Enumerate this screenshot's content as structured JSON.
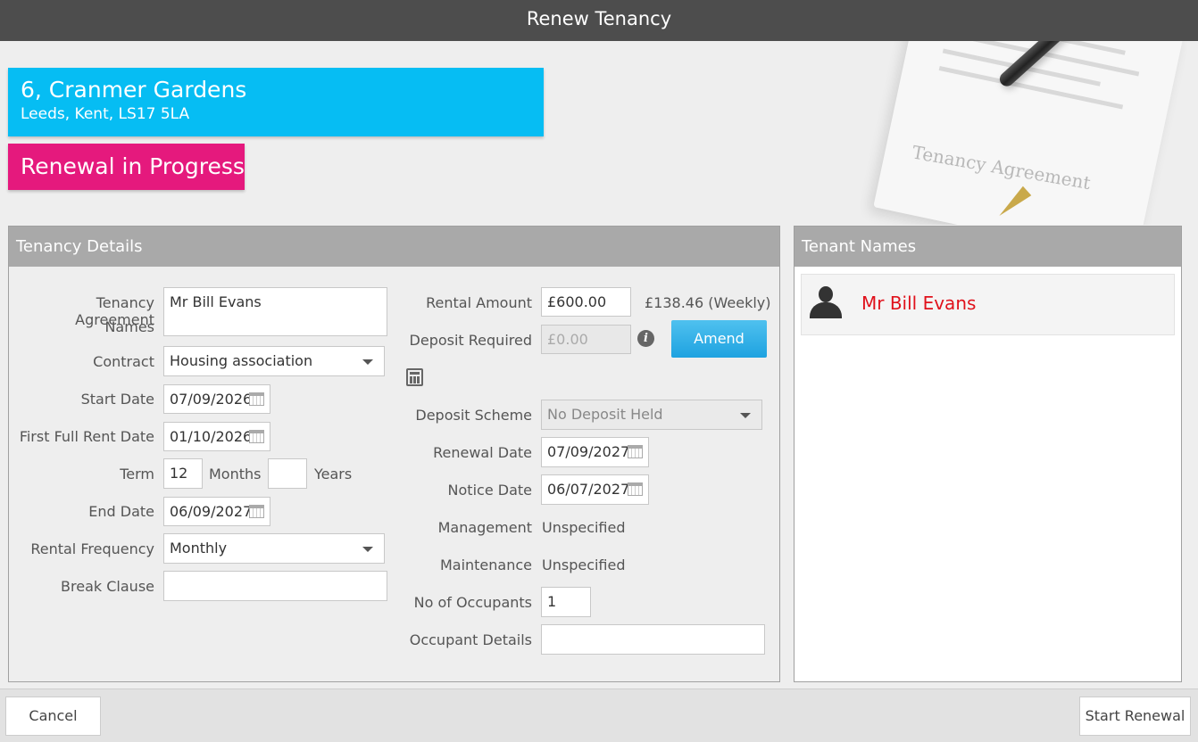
{
  "window": {
    "title": "Renew Tenancy"
  },
  "hero": {
    "stamp_text": "Tenancy Agreement"
  },
  "property": {
    "address_line1": "6, Cranmer Gardens",
    "address_line2": "Leeds, Kent, LS17 5LA"
  },
  "status": "Renewal in Progress",
  "details": {
    "header": "Tenancy Details",
    "agreement_names_label_1": "Tenancy Agreement",
    "agreement_names_label_2": "Names",
    "agreement_names_value": "Mr Bill Evans",
    "contract_label": "Contract",
    "contract_value": "Housing association",
    "start_date_label": "Start Date",
    "start_date_value": "07/09/2026",
    "first_full_rent_label": "First Full Rent Date",
    "first_full_rent_value": "01/10/2026",
    "term_label": "Term",
    "term_months_value": "12",
    "months_label": "Months",
    "term_years_value": "",
    "years_label": "Years",
    "end_date_label": "End Date",
    "end_date_value": "06/09/2027",
    "rental_frequency_label": "Rental Frequency",
    "rental_frequency_value": "Monthly",
    "break_clause_label": "Break Clause",
    "break_clause_value": "",
    "rental_amount_label": "Rental Amount",
    "rental_amount_value": "£600.00",
    "weekly_amount": "£138.46 (Weekly)",
    "deposit_required_label": "Deposit Required",
    "deposit_required_placeholder": "£0.00",
    "amend_label": "Amend",
    "deposit_scheme_label": "Deposit Scheme",
    "deposit_scheme_value": "No Deposit Held",
    "renewal_date_label": "Renewal Date",
    "renewal_date_value": "07/09/2027",
    "notice_date_label": "Notice Date",
    "notice_date_value": "06/07/2027",
    "management_label": "Management",
    "management_value": "Unspecified",
    "maintenance_label": "Maintenance",
    "maintenance_value": "Unspecified",
    "occupants_label": "No of Occupants",
    "occupants_value": "1",
    "occupant_details_label": "Occupant Details",
    "occupant_details_value": ""
  },
  "tenants": {
    "header": "Tenant Names",
    "items": [
      {
        "name": "Mr Bill Evans"
      }
    ]
  },
  "footer": {
    "cancel_label": "Cancel",
    "start_label": "Start Renewal"
  },
  "colors": {
    "title_bar": "#4d4d4d",
    "address_bg": "#06bdf3",
    "status_bg": "#e5197d",
    "amend_bg": "#1ea2e0",
    "tenant_name": "#e0111b"
  },
  "icons": {
    "calendar": "calendar-icon",
    "info": "info-icon",
    "calculator": "calculator-icon",
    "person": "person-icon",
    "dropdown": "chevron-down-icon"
  }
}
